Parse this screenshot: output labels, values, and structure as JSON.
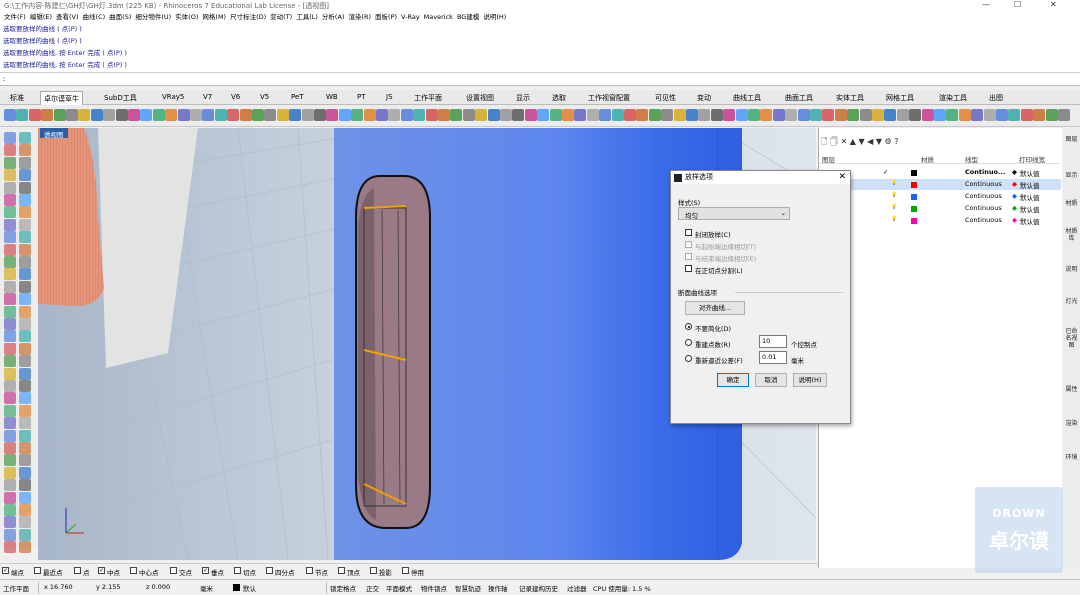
{
  "title": {
    "text": "G:\\工作内容-陈建仁\\GH灯\\GH灯.3dm (225 KB) - Rhinoceros 7 Educational Lab License - [透视图]"
  },
  "window_controls": {
    "min": "—",
    "max": "☐",
    "close": "✕"
  },
  "menu": [
    "文件(F)",
    "编辑(E)",
    "查看(V)",
    "曲线(C)",
    "曲面(S)",
    "细分物件(U)",
    "实体(O)",
    "网格(M)",
    "尺寸标注(D)",
    "变动(T)",
    "工具(L)",
    "分析(A)",
    "渲染(R)",
    "面板(P)",
    "V-Ray",
    "Maverick",
    "BG建模",
    "说明(H)"
  ],
  "history": [
    "选取要放样的曲线 ( 点(P) )",
    "选取要放样的曲线 ( 点(P) )",
    "选取要放样的曲线, 按 Enter 完成 ( 点(P) )",
    "选取要放样的曲线, 按 Enter 完成 ( 点(P) )"
  ],
  "command_prompt": ":",
  "tabs": [
    "标准",
    "卓尔谟草牛",
    "SubD工具",
    "VRay5",
    "V7",
    "V6",
    "V5",
    "PeT",
    "WB",
    "PT",
    "JS",
    "工作平面",
    "设置视图",
    "显示",
    "选取",
    "工作视窗配置",
    "可见性",
    "变动",
    "曲线工具",
    "曲面工具",
    "实体工具",
    "网格工具",
    "渲染工具",
    "出图"
  ],
  "active_tab": 1,
  "viewport": {
    "label": "透视图"
  },
  "layers": {
    "header": {
      "name": "图层",
      "material": "材质",
      "linetype": "线型",
      "print_color": "打印线宽"
    },
    "rows": [
      {
        "linetype": "Continuo...",
        "print": "默认值",
        "color": "#000000",
        "check": "✓"
      },
      {
        "linetype": "Continuous",
        "print": "默认值",
        "color": "#ff0000",
        "check": ""
      },
      {
        "linetype": "Continuous",
        "print": "默认值",
        "color": "#1a5fff",
        "check": ""
      },
      {
        "linetype": "Continuous",
        "print": "默认值",
        "color": "#00aa00",
        "check": ""
      },
      {
        "linetype": "Continuous",
        "print": "默认值",
        "color": "#ff00aa",
        "check": ""
      }
    ]
  },
  "side_tabs": [
    "图层",
    "显示",
    "材质",
    "材质库",
    "说明",
    "灯光",
    "已命名视图",
    "属性",
    "渲染",
    "环境"
  ],
  "dialog": {
    "title": "放样选项",
    "style_label": "样式(S)",
    "style_value": "均匀",
    "closed_loft": "封闭放样(C)",
    "match_start": "与起始端边缘相切(T)",
    "match_end": "与结束端边缘相切(E)",
    "split_at_tangents": "在正切点分割(L)",
    "section_label": "断面曲线选项",
    "align_button": "对齐曲线...",
    "opt_no_simplify": "不要简化(D)",
    "opt_rebuild": "重建点数(R)",
    "rebuild_value": "10",
    "rebuild_unit": "个控制点",
    "opt_refit": "重新逼近公差(F)",
    "refit_value": "0.01",
    "refit_unit": "毫米",
    "ok": "确定",
    "cancel": "取消",
    "help": "说明(H)"
  },
  "osnap": [
    "端点",
    "最近点",
    "点",
    "中点",
    "中心点",
    "交点",
    "垂点",
    "切点",
    "四分点",
    "节点",
    "顶点",
    "投影",
    "停用"
  ],
  "osnap_checked": [
    true,
    false,
    false,
    true,
    false,
    false,
    true,
    false,
    false,
    false,
    false,
    false,
    false
  ],
  "status": {
    "cplane": "工作平面",
    "x": "x 16.760",
    "y": "y 2.155",
    "z": "z 0.000",
    "unit": "毫米",
    "layer": "默认",
    "items": [
      "锁定格点",
      "正交",
      "平面模式",
      "物件锁点",
      "智慧轨迹",
      "操作轴",
      "记录建构历史",
      "过滤器",
      "CPU 使用量: 1.5 %"
    ]
  },
  "watermark": {
    "line1": "DROWN",
    "line2": "卓尔谟"
  }
}
